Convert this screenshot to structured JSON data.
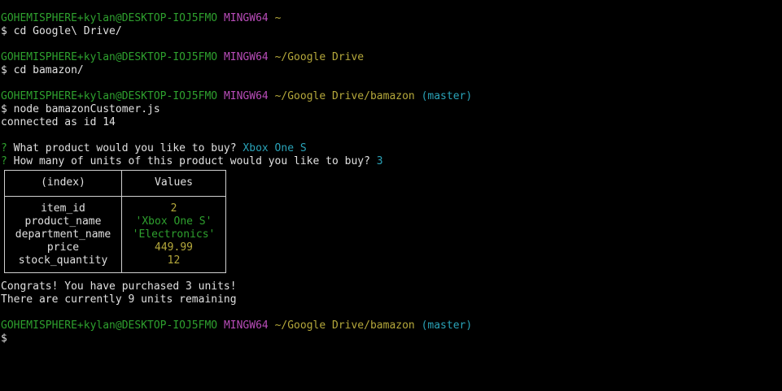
{
  "prompt": {
    "user_host": "GOHEMISPHERE+kylan@DESKTOP-IOJ5FMO",
    "system": "MINGW64",
    "sign": "$"
  },
  "blocks": [
    {
      "path": "~",
      "branch": "",
      "command": "cd Google\\ Drive/"
    },
    {
      "path": "~/Google Drive",
      "branch": "",
      "command": "cd bamazon/"
    },
    {
      "path": "~/Google Drive/bamazon",
      "branch": "(master)",
      "command": "node bamazonCustomer.js"
    }
  ],
  "output": {
    "connected": "connected as id 14",
    "q1_mark": "?",
    "q1_text": "What product would you like to buy?",
    "q1_answer": "Xbox One S",
    "q2_mark": "?",
    "q2_text": "How many of units of this product would you like to buy?",
    "q2_answer": "3"
  },
  "table": {
    "headers": [
      "(index)",
      "Values"
    ],
    "rows": [
      {
        "key": "item_id",
        "value": "2",
        "type": "num"
      },
      {
        "key": "product_name",
        "value": "'Xbox One S'",
        "type": "str"
      },
      {
        "key": "department_name",
        "value": "'Electronics'",
        "type": "str"
      },
      {
        "key": "price",
        "value": "449.99",
        "type": "num"
      },
      {
        "key": "stock_quantity",
        "value": "12",
        "type": "num"
      }
    ]
  },
  "result": {
    "congrats": "Congrats! You have purchased 3 units!",
    "remaining": "There are currently 9 units remaining"
  },
  "final_prompt": {
    "path": "~/Google Drive/bamazon",
    "branch": "(master)"
  },
  "colors": {
    "background": "#000000",
    "text": "#e0e0e0",
    "user_host": "#2ea02e",
    "system": "#b84cb8",
    "path": "#b5a83b",
    "branch": "#2aa3b8",
    "question": "#2ea02e",
    "answer": "#2aa3b8",
    "string": "#2ea02e",
    "number": "#b5a83b"
  }
}
